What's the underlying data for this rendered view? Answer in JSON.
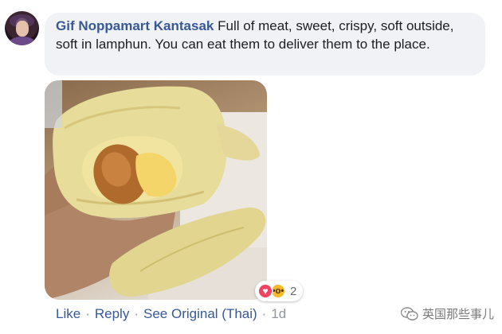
{
  "comment": {
    "author": "Gif Noppamart Kantasak",
    "text": "Full of meat, sweet, crispy, soft outside, soft in lamphun. You can eat them to deliver them to the place."
  },
  "photo": {
    "subject": "durian-photo"
  },
  "reactions": {
    "icons": [
      "love-icon",
      "wow-icon"
    ],
    "count": "2"
  },
  "actions": {
    "like": "Like",
    "reply": "Reply",
    "see_original": "See Original (Thai)",
    "separator": "·",
    "time": "1d"
  },
  "watermark": {
    "text": "英国那些事儿"
  },
  "colors": {
    "link": "#385898",
    "bubble": "#f0f2f5",
    "meta": "#90949c"
  }
}
